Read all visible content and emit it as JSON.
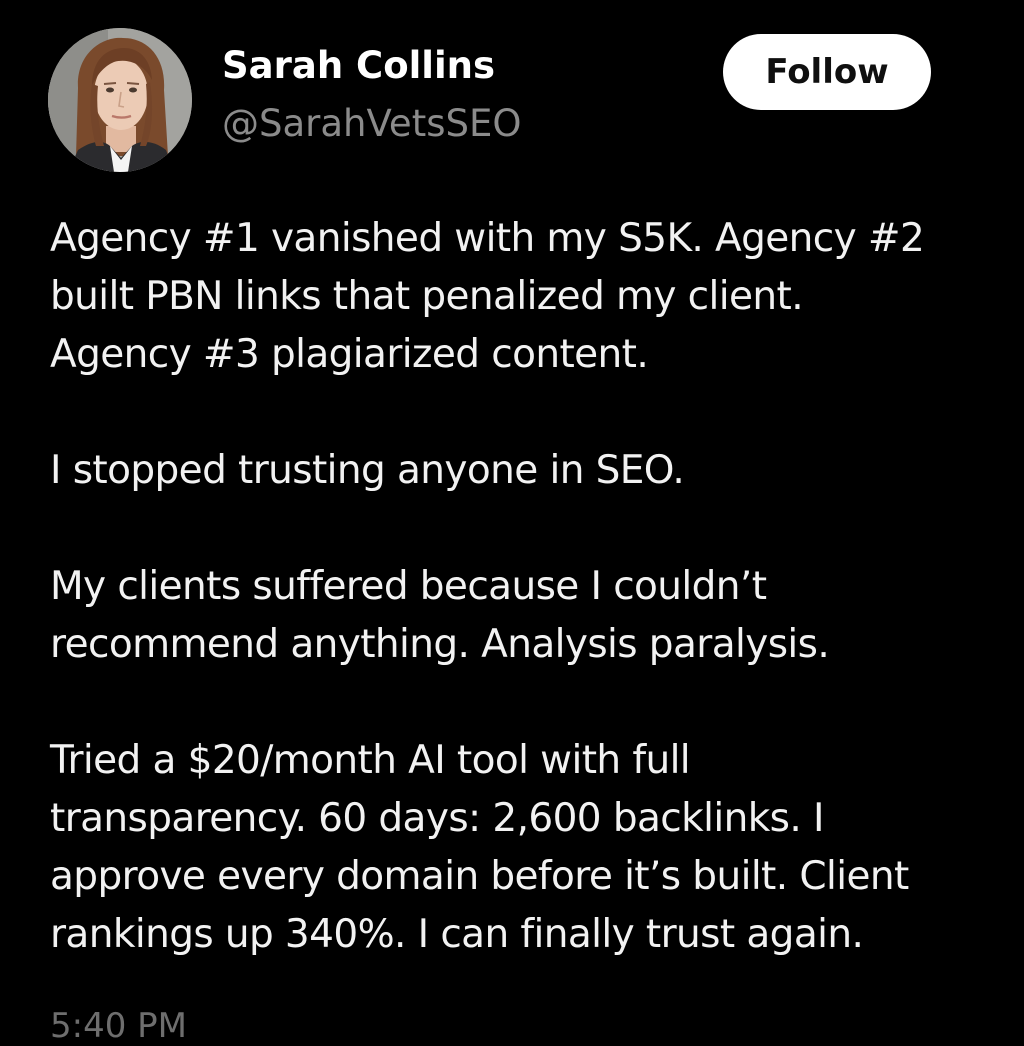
{
  "author": {
    "display_name": "Sarah Collins",
    "handle": "@SarahVetsSEO",
    "avatar_icon": "profile-photo"
  },
  "follow_button": {
    "label": "Follow"
  },
  "post": {
    "paragraphs": [
      {
        "lines": [
          "Agency #1 vanished with my S5K. Agency #2",
          "built PBN links that penalized my client.",
          "Agency #3 plagiarized content."
        ]
      },
      {
        "lines": [
          "I stopped trusting anyone in SEO."
        ]
      },
      {
        "lines": [
          "My clients suffered because I couldn’t",
          "recommend anything. Analysis paralysis."
        ]
      },
      {
        "lines": [
          "Tried a $20/month AI tool with full",
          "transparency. 60 days: 2,600 backlinks. I",
          "approve every domain before it’s built. Client",
          "rankings up 340%. I can finally trust again."
        ]
      }
    ],
    "timestamp": "5:40 PM"
  },
  "colors": {
    "background": "#000000",
    "text": "#f2f2f2",
    "secondary_text": "#8b8b8b",
    "button_bg": "#ffffff",
    "button_text": "#0f0f0f"
  }
}
